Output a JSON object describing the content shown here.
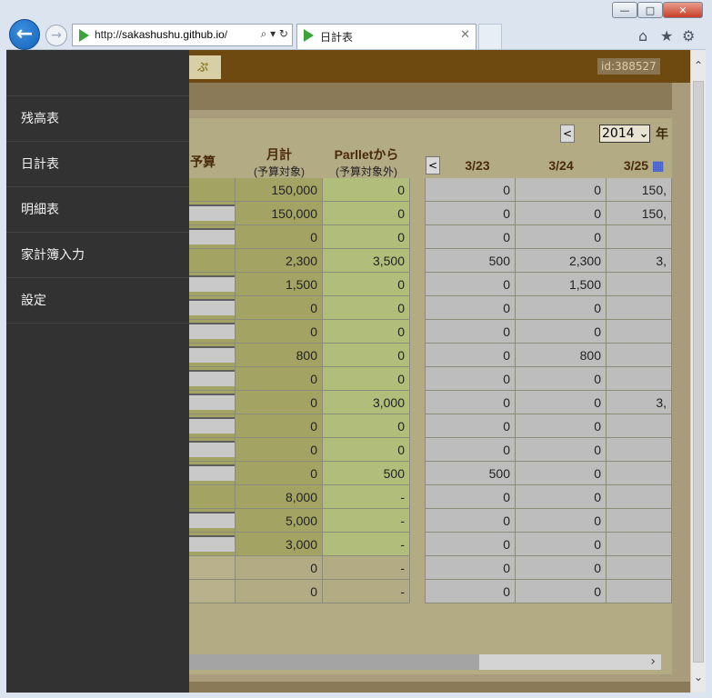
{
  "browser": {
    "url_host": "sakashushu.github.io",
    "url_prefix": "http://",
    "url_suffix": "/",
    "tab_title": "日計表",
    "window_controls": [
      "minimize",
      "maximize",
      "close"
    ],
    "close_glyph": "✕",
    "back_glyph": "←",
    "forward_glyph": "→",
    "address_tools": "⌕ ▾ ↻",
    "tab_close_glyph": "✕",
    "right_icons": [
      "home-icon",
      "star-icon",
      "gear-icon"
    ]
  },
  "header": {
    "user_id": "id:388527",
    "logo_text": "ぷ"
  },
  "sidebar": {
    "items": [
      {
        "label": "残高表"
      },
      {
        "label": "日計表"
      },
      {
        "label": "明細表"
      },
      {
        "label": "家計簿入力"
      },
      {
        "label": "設定"
      }
    ]
  },
  "controls": {
    "prev_glyph": "<",
    "year": "2014",
    "year_suffix": "年",
    "scroll_right_glyph": "›",
    "scroll_up_glyph": "⌃",
    "scroll_down_glyph": "⌄"
  },
  "columns": {
    "budget": "予算",
    "month_total": "月計",
    "month_total_sub": "(予算対象)",
    "parllet": "Parlletから",
    "parllet_sub": "(予算対象外)",
    "days": [
      "3/23",
      "3/24",
      "3/25"
    ]
  },
  "rows": [
    {
      "budget_input": false,
      "month": "150,000",
      "parllet": "0",
      "d1": "0",
      "d2": "0",
      "d3": "150,"
    },
    {
      "budget_input": true,
      "month": "150,000",
      "parllet": "0",
      "d1": "0",
      "d2": "0",
      "d3": "150,"
    },
    {
      "budget_input": true,
      "month": "0",
      "parllet": "0",
      "d1": "0",
      "d2": "0",
      "d3": ""
    },
    {
      "budget_input": false,
      "month": "2,300",
      "parllet": "3,500",
      "d1": "500",
      "d2": "2,300",
      "d3": "3,"
    },
    {
      "budget_input": true,
      "month": "1,500",
      "parllet": "0",
      "d1": "0",
      "d2": "1,500",
      "d3": ""
    },
    {
      "budget_input": true,
      "month": "0",
      "parllet": "0",
      "d1": "0",
      "d2": "0",
      "d3": ""
    },
    {
      "budget_input": true,
      "month": "0",
      "parllet": "0",
      "d1": "0",
      "d2": "0",
      "d3": ""
    },
    {
      "budget_input": true,
      "month": "800",
      "parllet": "0",
      "d1": "0",
      "d2": "800",
      "d3": ""
    },
    {
      "budget_input": true,
      "month": "0",
      "parllet": "0",
      "d1": "0",
      "d2": "0",
      "d3": ""
    },
    {
      "budget_input": true,
      "month": "0",
      "parllet": "3,000",
      "d1": "0",
      "d2": "0",
      "d3": "3,"
    },
    {
      "budget_input": true,
      "month": "0",
      "parllet": "0",
      "d1": "0",
      "d2": "0",
      "d3": ""
    },
    {
      "budget_input": true,
      "month": "0",
      "parllet": "0",
      "d1": "0",
      "d2": "0",
      "d3": ""
    },
    {
      "budget_input": true,
      "month": "0",
      "parllet": "500",
      "d1": "500",
      "d2": "0",
      "d3": ""
    },
    {
      "budget_input": false,
      "month": "8,000",
      "parllet": "-",
      "d1": "0",
      "d2": "0",
      "d3": ""
    },
    {
      "budget_input": true,
      "month": "5,000",
      "parllet": "-",
      "d1": "0",
      "d2": "0",
      "d3": ""
    },
    {
      "budget_input": true,
      "month": "3,000",
      "parllet": "-",
      "d1": "0",
      "d2": "0",
      "d3": ""
    },
    {
      "budget_input": false,
      "gray": true,
      "month": "0",
      "parllet": "-",
      "d1": "0",
      "d2": "0",
      "d3": ""
    },
    {
      "budget_input": false,
      "gray": true,
      "month": "0",
      "parllet": "-",
      "d1": "0",
      "d2": "0",
      "d3": ""
    }
  ]
}
